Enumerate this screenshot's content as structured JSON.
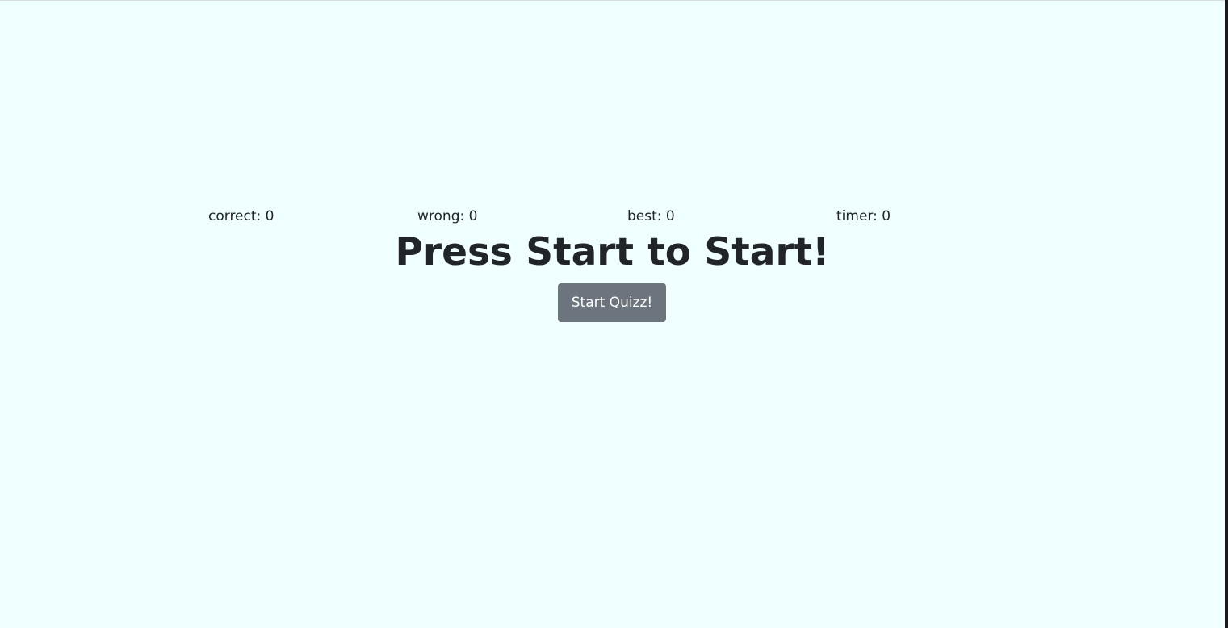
{
  "stats": {
    "correct": {
      "label": "correct",
      "value": "0"
    },
    "wrong": {
      "label": "wrong",
      "value": "0"
    },
    "best": {
      "label": "best",
      "value": "0"
    },
    "timer": {
      "label": "timer",
      "value": "0"
    }
  },
  "main": {
    "title": "Press Start to Start!",
    "start_button_label": "Start Quizz!"
  },
  "colors": {
    "background": "#f0ffff",
    "text": "#212529",
    "button": "#6c757d",
    "button_text": "#ffffff"
  }
}
